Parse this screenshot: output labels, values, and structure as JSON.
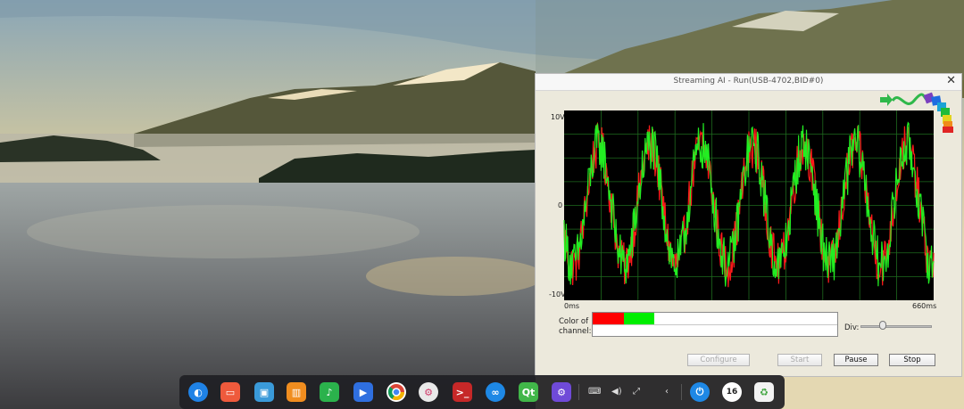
{
  "window": {
    "title": "Streaming AI - Run(USB-4702,BID#0)",
    "close_glyph": "✕"
  },
  "chart": {
    "y_top_label": "10V",
    "y_mid_label": "0",
    "y_bottom_label": "-10V",
    "x_left_label": "0ms",
    "x_right_label": "660ms"
  },
  "chart_data": {
    "type": "line",
    "title": "",
    "xlabel": "",
    "ylabel": "",
    "xlim": [
      0,
      660
    ],
    "ylim": [
      -10,
      10
    ],
    "x_ticks": [
      "0ms",
      "660ms"
    ],
    "y_ticks": [
      "10V",
      "0",
      "-10V"
    ],
    "grid": true,
    "background": "#000000",
    "series": [
      {
        "color": "#ff1a1a",
        "cycles": 7.2,
        "amplitude": 6.3,
        "noise": 2.4
      },
      {
        "color": "#22ee22",
        "cycles": 7.2,
        "amplitude": 6.3,
        "noise": 2.6
      }
    ]
  },
  "channels": {
    "label": "Color of channel:",
    "colors": [
      "#ff0000",
      "#00ee00"
    ]
  },
  "div_label": "Div:",
  "div_slider_value": 0.2,
  "buttons": {
    "configure": "Configure",
    "start": "Start",
    "pause": "Pause",
    "stop": "Stop"
  },
  "taskbar": {
    "apps": [
      "launcher-icon",
      "multitask-view-icon",
      "file-manager-icon",
      "app-store-icon",
      "music-icon",
      "video-icon",
      "chrome-icon",
      "settings-icon",
      "terminal-icon",
      "connect-icon",
      "qt-creator-icon",
      "device-manager-icon"
    ],
    "tray": [
      "keyboard-icon",
      "volume-icon",
      "network-icon",
      "expand-icon"
    ],
    "power_icon": "power-icon",
    "clock_text": "16",
    "trash_icon": "trash-icon"
  }
}
